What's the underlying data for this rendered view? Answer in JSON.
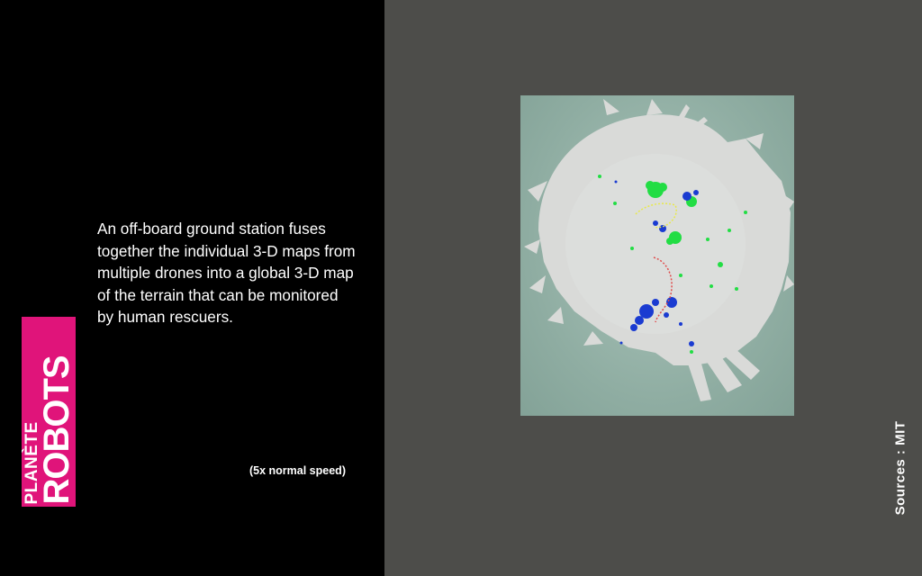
{
  "caption": {
    "line1": "An off-board ground station fuses",
    "line2": "together the individual 3-D maps from",
    "line3": "multiple drones into a global 3-D map",
    "line4": "of the terrain that can be monitored",
    "line5": "by human rescuers."
  },
  "speed_note": "(5x normal speed)",
  "logo": {
    "line1": "PLANÈTE",
    "line2": "ROBOTS"
  },
  "sources": "Sources : MIT",
  "colors": {
    "logo_bg": "#e0147a",
    "left_bg": "#000000",
    "right_bg": "#4d4d4a",
    "map_bg": "#8fada2",
    "map_scan": "#d9dad8",
    "points_green": "#22dd44",
    "points_blue": "#1a3bd1",
    "path_yellow": "#e8e84a",
    "path_red": "#e04a4a"
  }
}
